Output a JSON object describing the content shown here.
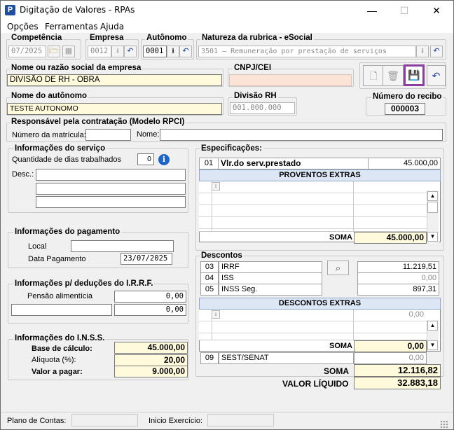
{
  "window": {
    "title": "Digitação de Valores - RPAs",
    "minimize": "—",
    "maximize": "☐",
    "close": "✕"
  },
  "menu": [
    "Opções",
    "Ferramentas",
    "Ajuda"
  ],
  "competencia": {
    "label": "Competência",
    "value": "07/2025"
  },
  "empresa": {
    "label": "Empresa",
    "value": "0012"
  },
  "autonomo": {
    "label": "Autônomo",
    "value": "0001"
  },
  "natureza": {
    "label": "Natureza da rubrica - eSocial",
    "value": "3501 – Remuneração por prestação de serviços"
  },
  "empresa_nome": {
    "label": "Nome ou razão social da empresa",
    "value": "DIVISÃO DE RH - OBRA"
  },
  "cnpj": {
    "label": "CNPJ/CEI",
    "value": ""
  },
  "autonomo_nome": {
    "label": "Nome do autônomo",
    "value": "TESTE AUTONOMO"
  },
  "divisao_rh": {
    "label": "Divisão RH",
    "value": "001.000.000"
  },
  "recibo": {
    "label": "Número do recibo",
    "value": "000003"
  },
  "responsavel": {
    "label": "Responsável pela contratação (Modelo RPCI)",
    "matricula_label": "Número da matrícula:",
    "nome_label": "Nome:"
  },
  "servico": {
    "label": "Informações do serviço",
    "dias_label": "Quantidade de dias trabalhados",
    "dias_value": "0",
    "desc_label": "Desc.:"
  },
  "pagamento": {
    "label": "Informações do pagamento",
    "local_label": "Local",
    "data_label": "Data Pagamento",
    "data_value": "23/07/2025"
  },
  "irrf_deducoes": {
    "label": "Informações p/ deduções do I.R.R.F.",
    "pensao_label": "Pensão alimentícia",
    "pensao_value": "0,00",
    "outro_value": "0,00"
  },
  "inss": {
    "label": "Informações do I.N.S.S.",
    "base_label": "Base de cálculo:",
    "base_value": "45.000,00",
    "aliquota_label": "Alíquota (%):",
    "aliquota_value": "20,00",
    "valor_label": "Valor a pagar:",
    "valor_value": "9.000,00"
  },
  "especificacoes": {
    "label": "Especificações:",
    "main_code": "01",
    "main_desc": "Vlr.do serv.prestado",
    "main_value": "45.000,00",
    "extras_header": "PROVENTOS EXTRAS",
    "soma_label": "SOMA",
    "soma_value": "45.000,00"
  },
  "descontos": {
    "label": "Descontos",
    "rows": [
      {
        "code": "03",
        "name": "IRRF",
        "value": "11.219,51"
      },
      {
        "code": "04",
        "name": "ISS",
        "value": "0,00"
      },
      {
        "code": "05",
        "name": "INSS Seg.",
        "value": "897,31"
      }
    ],
    "extras_header": "DESCONTOS EXTRAS",
    "extras_row_value": "0,00",
    "soma_label": "SOMA",
    "soma_value": "0,00",
    "sest_code": "09",
    "sest_name": "SEST/SENAT",
    "sest_value": "0,00"
  },
  "totais": {
    "soma_label": "SOMA",
    "soma_value": "12.116,82",
    "liquido_label": "VALOR LÍQUIDO",
    "liquido_value": "32.883,18"
  },
  "status": {
    "plano_label": "Plano de Contas:",
    "exercicio_label": "Inicio Exercício:"
  }
}
